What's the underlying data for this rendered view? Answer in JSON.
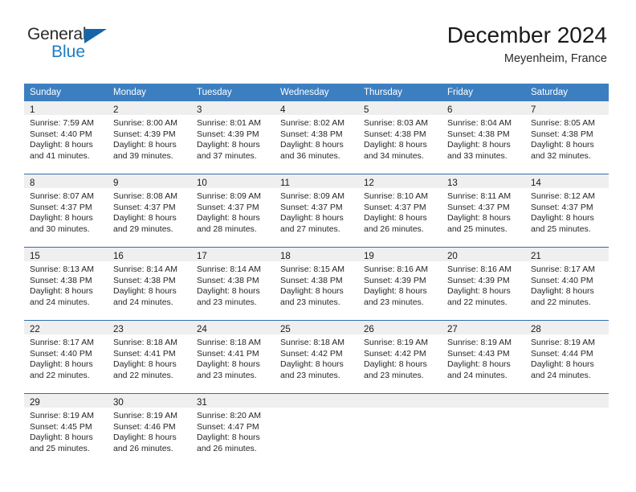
{
  "brand": {
    "name_part1": "General",
    "name_part2": "Blue",
    "triangle_icon": "triangle-icon",
    "accent_color": "#1d7dc4",
    "triangle_color": "#1566a8"
  },
  "header": {
    "title": "December 2024",
    "subtitle": "Meyenheim, France"
  },
  "calendar": {
    "header_bg_color": "#3c7fc1",
    "daynum_band_color": "#efefef",
    "week_divider_color": "#2f6fae",
    "weekday_headers": [
      "Sunday",
      "Monday",
      "Tuesday",
      "Wednesday",
      "Thursday",
      "Friday",
      "Saturday"
    ],
    "weeks": [
      [
        {
          "day": "1",
          "sunrise": "Sunrise: 7:59 AM",
          "sunset": "Sunset: 4:40 PM",
          "daylight_line1": "Daylight: 8 hours",
          "daylight_line2": "and 41 minutes."
        },
        {
          "day": "2",
          "sunrise": "Sunrise: 8:00 AM",
          "sunset": "Sunset: 4:39 PM",
          "daylight_line1": "Daylight: 8 hours",
          "daylight_line2": "and 39 minutes."
        },
        {
          "day": "3",
          "sunrise": "Sunrise: 8:01 AM",
          "sunset": "Sunset: 4:39 PM",
          "daylight_line1": "Daylight: 8 hours",
          "daylight_line2": "and 37 minutes."
        },
        {
          "day": "4",
          "sunrise": "Sunrise: 8:02 AM",
          "sunset": "Sunset: 4:38 PM",
          "daylight_line1": "Daylight: 8 hours",
          "daylight_line2": "and 36 minutes."
        },
        {
          "day": "5",
          "sunrise": "Sunrise: 8:03 AM",
          "sunset": "Sunset: 4:38 PM",
          "daylight_line1": "Daylight: 8 hours",
          "daylight_line2": "and 34 minutes."
        },
        {
          "day": "6",
          "sunrise": "Sunrise: 8:04 AM",
          "sunset": "Sunset: 4:38 PM",
          "daylight_line1": "Daylight: 8 hours",
          "daylight_line2": "and 33 minutes."
        },
        {
          "day": "7",
          "sunrise": "Sunrise: 8:05 AM",
          "sunset": "Sunset: 4:38 PM",
          "daylight_line1": "Daylight: 8 hours",
          "daylight_line2": "and 32 minutes."
        }
      ],
      [
        {
          "day": "8",
          "sunrise": "Sunrise: 8:07 AM",
          "sunset": "Sunset: 4:37 PM",
          "daylight_line1": "Daylight: 8 hours",
          "daylight_line2": "and 30 minutes."
        },
        {
          "day": "9",
          "sunrise": "Sunrise: 8:08 AM",
          "sunset": "Sunset: 4:37 PM",
          "daylight_line1": "Daylight: 8 hours",
          "daylight_line2": "and 29 minutes."
        },
        {
          "day": "10",
          "sunrise": "Sunrise: 8:09 AM",
          "sunset": "Sunset: 4:37 PM",
          "daylight_line1": "Daylight: 8 hours",
          "daylight_line2": "and 28 minutes."
        },
        {
          "day": "11",
          "sunrise": "Sunrise: 8:09 AM",
          "sunset": "Sunset: 4:37 PM",
          "daylight_line1": "Daylight: 8 hours",
          "daylight_line2": "and 27 minutes."
        },
        {
          "day": "12",
          "sunrise": "Sunrise: 8:10 AM",
          "sunset": "Sunset: 4:37 PM",
          "daylight_line1": "Daylight: 8 hours",
          "daylight_line2": "and 26 minutes."
        },
        {
          "day": "13",
          "sunrise": "Sunrise: 8:11 AM",
          "sunset": "Sunset: 4:37 PM",
          "daylight_line1": "Daylight: 8 hours",
          "daylight_line2": "and 25 minutes."
        },
        {
          "day": "14",
          "sunrise": "Sunrise: 8:12 AM",
          "sunset": "Sunset: 4:37 PM",
          "daylight_line1": "Daylight: 8 hours",
          "daylight_line2": "and 25 minutes."
        }
      ],
      [
        {
          "day": "15",
          "sunrise": "Sunrise: 8:13 AM",
          "sunset": "Sunset: 4:38 PM",
          "daylight_line1": "Daylight: 8 hours",
          "daylight_line2": "and 24 minutes."
        },
        {
          "day": "16",
          "sunrise": "Sunrise: 8:14 AM",
          "sunset": "Sunset: 4:38 PM",
          "daylight_line1": "Daylight: 8 hours",
          "daylight_line2": "and 24 minutes."
        },
        {
          "day": "17",
          "sunrise": "Sunrise: 8:14 AM",
          "sunset": "Sunset: 4:38 PM",
          "daylight_line1": "Daylight: 8 hours",
          "daylight_line2": "and 23 minutes."
        },
        {
          "day": "18",
          "sunrise": "Sunrise: 8:15 AM",
          "sunset": "Sunset: 4:38 PM",
          "daylight_line1": "Daylight: 8 hours",
          "daylight_line2": "and 23 minutes."
        },
        {
          "day": "19",
          "sunrise": "Sunrise: 8:16 AM",
          "sunset": "Sunset: 4:39 PM",
          "daylight_line1": "Daylight: 8 hours",
          "daylight_line2": "and 23 minutes."
        },
        {
          "day": "20",
          "sunrise": "Sunrise: 8:16 AM",
          "sunset": "Sunset: 4:39 PM",
          "daylight_line1": "Daylight: 8 hours",
          "daylight_line2": "and 22 minutes."
        },
        {
          "day": "21",
          "sunrise": "Sunrise: 8:17 AM",
          "sunset": "Sunset: 4:40 PM",
          "daylight_line1": "Daylight: 8 hours",
          "daylight_line2": "and 22 minutes."
        }
      ],
      [
        {
          "day": "22",
          "sunrise": "Sunrise: 8:17 AM",
          "sunset": "Sunset: 4:40 PM",
          "daylight_line1": "Daylight: 8 hours",
          "daylight_line2": "and 22 minutes."
        },
        {
          "day": "23",
          "sunrise": "Sunrise: 8:18 AM",
          "sunset": "Sunset: 4:41 PM",
          "daylight_line1": "Daylight: 8 hours",
          "daylight_line2": "and 22 minutes."
        },
        {
          "day": "24",
          "sunrise": "Sunrise: 8:18 AM",
          "sunset": "Sunset: 4:41 PM",
          "daylight_line1": "Daylight: 8 hours",
          "daylight_line2": "and 23 minutes."
        },
        {
          "day": "25",
          "sunrise": "Sunrise: 8:18 AM",
          "sunset": "Sunset: 4:42 PM",
          "daylight_line1": "Daylight: 8 hours",
          "daylight_line2": "and 23 minutes."
        },
        {
          "day": "26",
          "sunrise": "Sunrise: 8:19 AM",
          "sunset": "Sunset: 4:42 PM",
          "daylight_line1": "Daylight: 8 hours",
          "daylight_line2": "and 23 minutes."
        },
        {
          "day": "27",
          "sunrise": "Sunrise: 8:19 AM",
          "sunset": "Sunset: 4:43 PM",
          "daylight_line1": "Daylight: 8 hours",
          "daylight_line2": "and 24 minutes."
        },
        {
          "day": "28",
          "sunrise": "Sunrise: 8:19 AM",
          "sunset": "Sunset: 4:44 PM",
          "daylight_line1": "Daylight: 8 hours",
          "daylight_line2": "and 24 minutes."
        }
      ],
      [
        {
          "day": "29",
          "sunrise": "Sunrise: 8:19 AM",
          "sunset": "Sunset: 4:45 PM",
          "daylight_line1": "Daylight: 8 hours",
          "daylight_line2": "and 25 minutes."
        },
        {
          "day": "30",
          "sunrise": "Sunrise: 8:19 AM",
          "sunset": "Sunset: 4:46 PM",
          "daylight_line1": "Daylight: 8 hours",
          "daylight_line2": "and 26 minutes."
        },
        {
          "day": "31",
          "sunrise": "Sunrise: 8:20 AM",
          "sunset": "Sunset: 4:47 PM",
          "daylight_line1": "Daylight: 8 hours",
          "daylight_line2": "and 26 minutes."
        },
        {
          "day": "",
          "sunrise": "",
          "sunset": "",
          "daylight_line1": "",
          "daylight_line2": ""
        },
        {
          "day": "",
          "sunrise": "",
          "sunset": "",
          "daylight_line1": "",
          "daylight_line2": ""
        },
        {
          "day": "",
          "sunrise": "",
          "sunset": "",
          "daylight_line1": "",
          "daylight_line2": ""
        },
        {
          "day": "",
          "sunrise": "",
          "sunset": "",
          "daylight_line1": "",
          "daylight_line2": ""
        }
      ]
    ]
  }
}
